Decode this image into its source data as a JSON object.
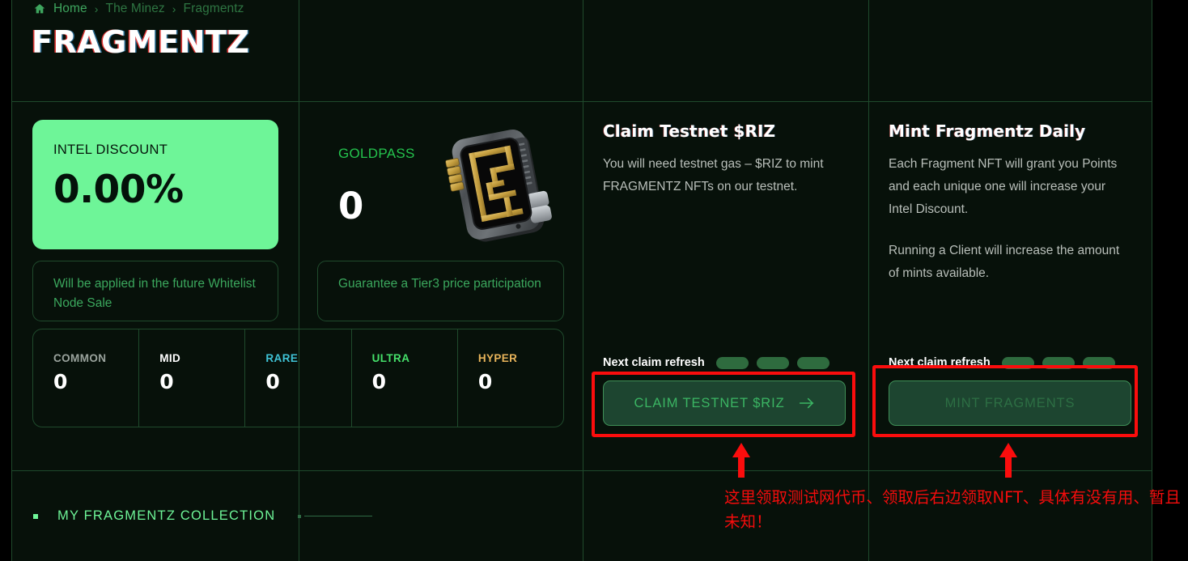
{
  "breadcrumb": {
    "home_icon": "home-icon",
    "items": [
      {
        "label": "Home"
      },
      {
        "label": "The Minez"
      },
      {
        "label": "Fragmentz"
      }
    ],
    "separator": "›"
  },
  "page_title": "FRAGMENTZ",
  "intel_card": {
    "label": "INTEL DISCOUNT",
    "value": "0.00%",
    "note": "Will be applied in the future Whitelist Node Sale",
    "bg_color": "#6EF598",
    "text_color": "#04120A"
  },
  "goldpass": {
    "label": "GOLDPASS",
    "value": "0",
    "note": "Guarantee a Tier3 price participation",
    "image_alt": "goldpass-chip-card",
    "label_color": "#24C24D"
  },
  "rarity": {
    "items": [
      {
        "name": "COMMON",
        "count": "0",
        "color": "#9aa39d"
      },
      {
        "name": "MID",
        "count": "0",
        "color": "#ffffff"
      },
      {
        "name": "RARE",
        "count": "0",
        "color": "#3fc3d6"
      },
      {
        "name": "ULTRA",
        "count": "0",
        "color": "#45e06a"
      },
      {
        "name": "HYPER",
        "count": "0",
        "color": "#e8b45a"
      }
    ]
  },
  "claim_panel": {
    "title": "Claim Testnet $RIZ",
    "body": "You will need testnet gas – $RIZ to mint FRAGMENTZ NFTs on our testnet.",
    "refresh_label": "Next claim refresh",
    "refresh_pills": 3,
    "button_label": "CLAIM TESTNET $RIZ",
    "button_icon": "arrow-right-icon",
    "button_disabled": false
  },
  "mint_panel": {
    "title": "Mint Fragmentz Daily",
    "body_1": "Each Fragment NFT will grant you Points and each unique one will increase your Intel Discount.",
    "body_2": "Running a Client will increase the amount of mints available.",
    "refresh_label": "Next claim refresh",
    "refresh_pills": 3,
    "button_label": "MINT FRAGMENTS",
    "button_disabled": true
  },
  "collection": {
    "title": "MY FRAGMENTZ COLLECTION",
    "bullet_color": "#6EF598"
  },
  "annotation": {
    "color": "#F40C0C",
    "text": "这里领取测试网代币、领取后右边领取NFT、具体有没有用、暂且未知！",
    "arrow_icon": "arrow-up-icon",
    "box_count": 2
  },
  "theme": {
    "page_bg": "#000000",
    "grid_bg": "#07110A",
    "grid_line": "#1F4A2C",
    "accent_green": "#6EF598",
    "muted_text": "#B9BFBA"
  }
}
